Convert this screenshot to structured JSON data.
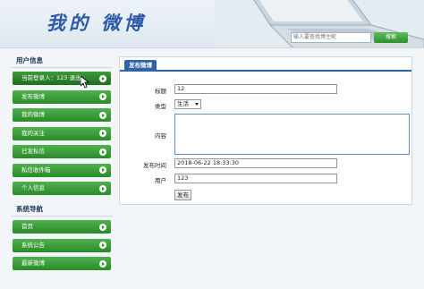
{
  "header": {
    "logo_text": "我的 微博",
    "search_placeholder": "输入要查找博主昵",
    "search_button": "搜索"
  },
  "sidebar": {
    "user_section_title": "用户信息",
    "user_items": [
      {
        "label": "当前登录人：123 退出",
        "icon": "arrow-right-icon"
      },
      {
        "label": "发布微博",
        "icon": "arrow-right-icon"
      },
      {
        "label": "我的微博",
        "icon": "arrow-right-icon"
      },
      {
        "label": "我的关注",
        "icon": "arrow-right-icon"
      },
      {
        "label": "已发私信",
        "icon": "arrow-right-icon"
      },
      {
        "label": "私信收件箱",
        "icon": "arrow-right-icon"
      },
      {
        "label": "个人信息",
        "icon": "arrow-right-icon"
      }
    ],
    "nav_section_title": "系统导航",
    "nav_items": [
      {
        "label": "首页",
        "icon": "arrow-right-icon"
      },
      {
        "label": "系统公告",
        "icon": "arrow-right-icon"
      },
      {
        "label": "最新微博",
        "icon": "arrow-right-icon"
      }
    ]
  },
  "form": {
    "tab_title": "发布微博",
    "title_label": "标题",
    "title_value": "12",
    "type_label": "类型",
    "type_value": "生活",
    "content_label": "内容",
    "content_value": "",
    "time_label": "发布时间",
    "time_value": "2018-06-22 18:33:30",
    "user_label": "用户",
    "user_value": "123",
    "submit_label": "发布"
  },
  "colors": {
    "menu_green": "#3a9e37",
    "accent_blue": "#2e63a6",
    "logo_blue": "#2c5aa8"
  }
}
